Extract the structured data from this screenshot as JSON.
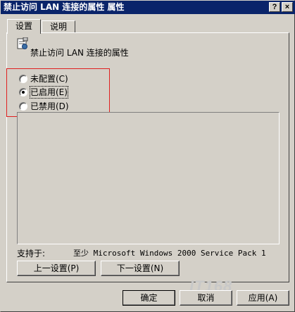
{
  "window": {
    "title": "禁止访问 LAN 连接的属性 属性",
    "help_label": "?",
    "close_label": "×"
  },
  "tabs": [
    {
      "label": "设置",
      "active": true
    },
    {
      "label": "说明",
      "active": false
    }
  ],
  "policy": {
    "icon": "policy-setting-icon",
    "name": "禁止访问 LAN 连接的属性"
  },
  "options": [
    {
      "label": "未配置(C)",
      "checked": false
    },
    {
      "label": "已启用(E)",
      "checked": true
    },
    {
      "label": "已禁用(D)",
      "checked": false
    }
  ],
  "supported": {
    "label": "支持于:",
    "value": "至少 Microsoft Windows 2000 Service Pack 1"
  },
  "nav_buttons": {
    "prev": "上一设置(P)",
    "next": "下一设置(N)"
  },
  "footer_buttons": {
    "ok": "确定",
    "cancel": "取消",
    "apply": "应用(A)"
  },
  "watermark": "IT168",
  "colors": {
    "titlebar": "#0a246a",
    "face": "#d4d0c8",
    "highlight_box": "#e02020"
  }
}
